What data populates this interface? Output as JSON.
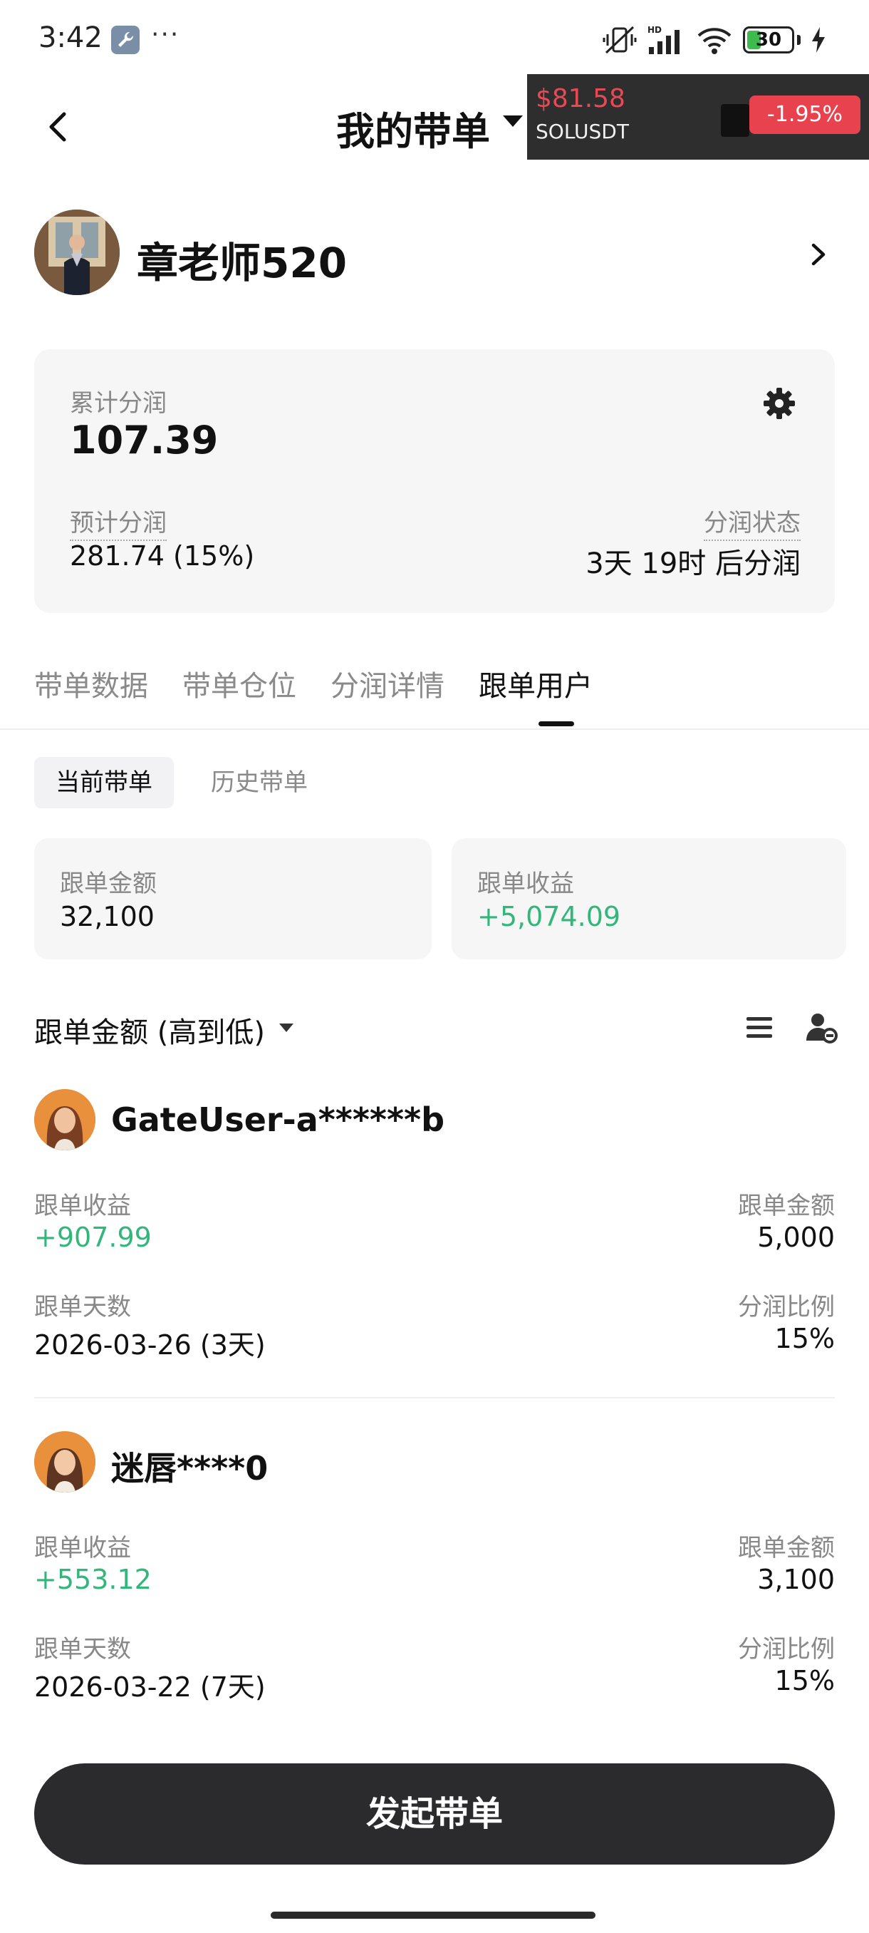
{
  "status_bar": {
    "time": "3:42",
    "more": "···",
    "battery_level": "30",
    "hd_label": "HD"
  },
  "header": {
    "title": "我的带单"
  },
  "ticker": {
    "price": "$81.58",
    "symbol": "SOLUSDT",
    "change": "-1.95%"
  },
  "profile": {
    "name": "章老师520"
  },
  "summary": {
    "cumulative_label": "累计分润",
    "cumulative_value": "107.39",
    "estimated_label": "预计分润",
    "estimated_value": "281.74 (15%)",
    "status_label": "分润状态",
    "status_value": "3天 19时 后分润"
  },
  "tabs": [
    {
      "label": "带单数据"
    },
    {
      "label": "带单仓位"
    },
    {
      "label": "分润详情"
    },
    {
      "label": "跟单用户"
    }
  ],
  "subtabs": {
    "current": "当前带单",
    "history": "历史带单"
  },
  "stats": {
    "amount_label": "跟单金额",
    "amount_value": "32,100",
    "profit_label": "跟单收益",
    "profit_value": "+5,074.09"
  },
  "sort": {
    "label": "跟单金额 (高到低)"
  },
  "followers": [
    {
      "name": "GateUser-a******b",
      "profit_label": "跟单收益",
      "profit_value": "+907.99",
      "amount_label": "跟单金额",
      "amount_value": "5,000",
      "days_label": "跟单天数",
      "days_value": "2026-03-26 (3天)",
      "ratio_label": "分润比例",
      "ratio_value": "15%"
    },
    {
      "name": "迷唇****0",
      "profit_label": "跟单收益",
      "profit_value": "+553.12",
      "amount_label": "跟单金额",
      "amount_value": "3,100",
      "days_label": "跟单天数",
      "days_value": "2026-03-22 (7天)",
      "ratio_label": "分润比例",
      "ratio_value": "15%"
    }
  ],
  "cta": {
    "label": "发起带单"
  },
  "colors": {
    "green": "#32b77b",
    "red": "#e8424f",
    "dark_button": "#2b2b2e"
  }
}
